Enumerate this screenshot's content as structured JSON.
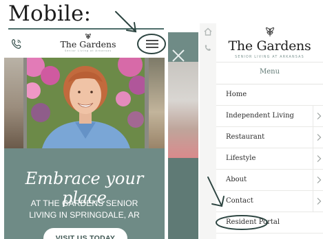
{
  "annotation": {
    "title": "Mobile:",
    "accent_color": "#4d6d69"
  },
  "left_phone": {
    "header": {
      "phone_icon": "phone-icon",
      "logo_name": "The Gardens",
      "logo_tagline": "Senior Living at Arkansas",
      "menu_icon": "hamburger-menu-icon"
    },
    "hero_image": "smiling-senior-woman-with-flowers",
    "tagline_script": "Embrace your place",
    "subtitle": "At The Gardens Senior Living in Springdale, AR",
    "cta_label": "VISIT US TODAY",
    "brand_color": "#6f8b86"
  },
  "middle_phone": {
    "close_icon": "close-icon"
  },
  "right_phone": {
    "logo_name": "The Gardens",
    "logo_tagline": "Senior Living at Arkansas",
    "menu_heading": "Menu",
    "menu_items": [
      {
        "label": "Home",
        "has_submenu": false
      },
      {
        "label": "Independent Living",
        "has_submenu": true
      },
      {
        "label": "Restaurant",
        "has_submenu": true
      },
      {
        "label": "Lifestyle",
        "has_submenu": true
      },
      {
        "label": "About",
        "has_submenu": true
      },
      {
        "label": "Contact",
        "has_submenu": true
      },
      {
        "label": "Resident Portal",
        "has_submenu": false
      }
    ],
    "rail_icons": [
      "home-icon",
      "phone-icon"
    ]
  }
}
